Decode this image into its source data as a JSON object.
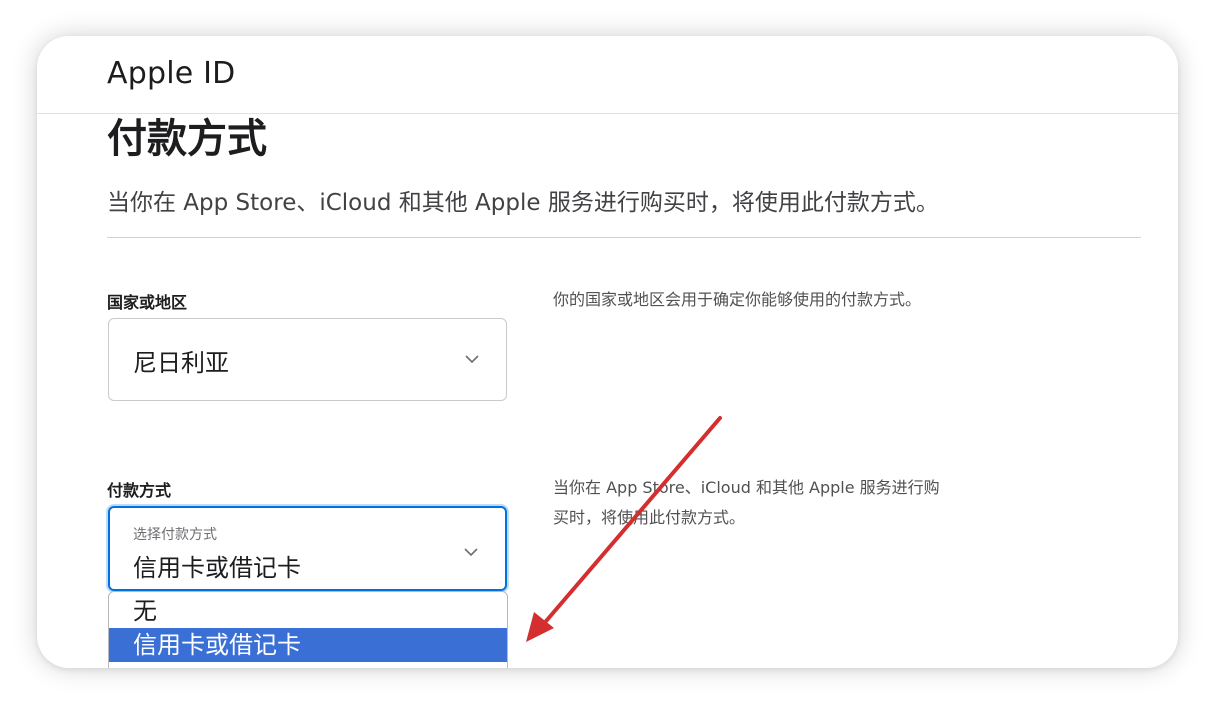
{
  "header": {
    "brand": "Apple ID"
  },
  "page": {
    "title": "付款方式",
    "intro": "当你在 App Store、iCloud 和其他 Apple 服务进行购买时，将使用此付款方式。"
  },
  "country_field": {
    "label": "国家或地区",
    "value": "尼日利亚",
    "help": "你的国家或地区会用于确定你能够使用的付款方式。"
  },
  "payment_field": {
    "label": "付款方式",
    "caption": "选择付款方式",
    "value": "信用卡或借记卡",
    "help": "当你在 App Store、iCloud 和其他 Apple 服务进行购买时，将使用此付款方式。",
    "options": [
      "无",
      "信用卡或借记卡"
    ],
    "selected_index": 1
  },
  "colors": {
    "accent": "#0071e3",
    "selected_option_bg": "#3a6fd6",
    "annotation_arrow": "#d32f2f"
  },
  "icons": {
    "chevron": "chevron-down-icon",
    "annotation": "red-arrow"
  }
}
